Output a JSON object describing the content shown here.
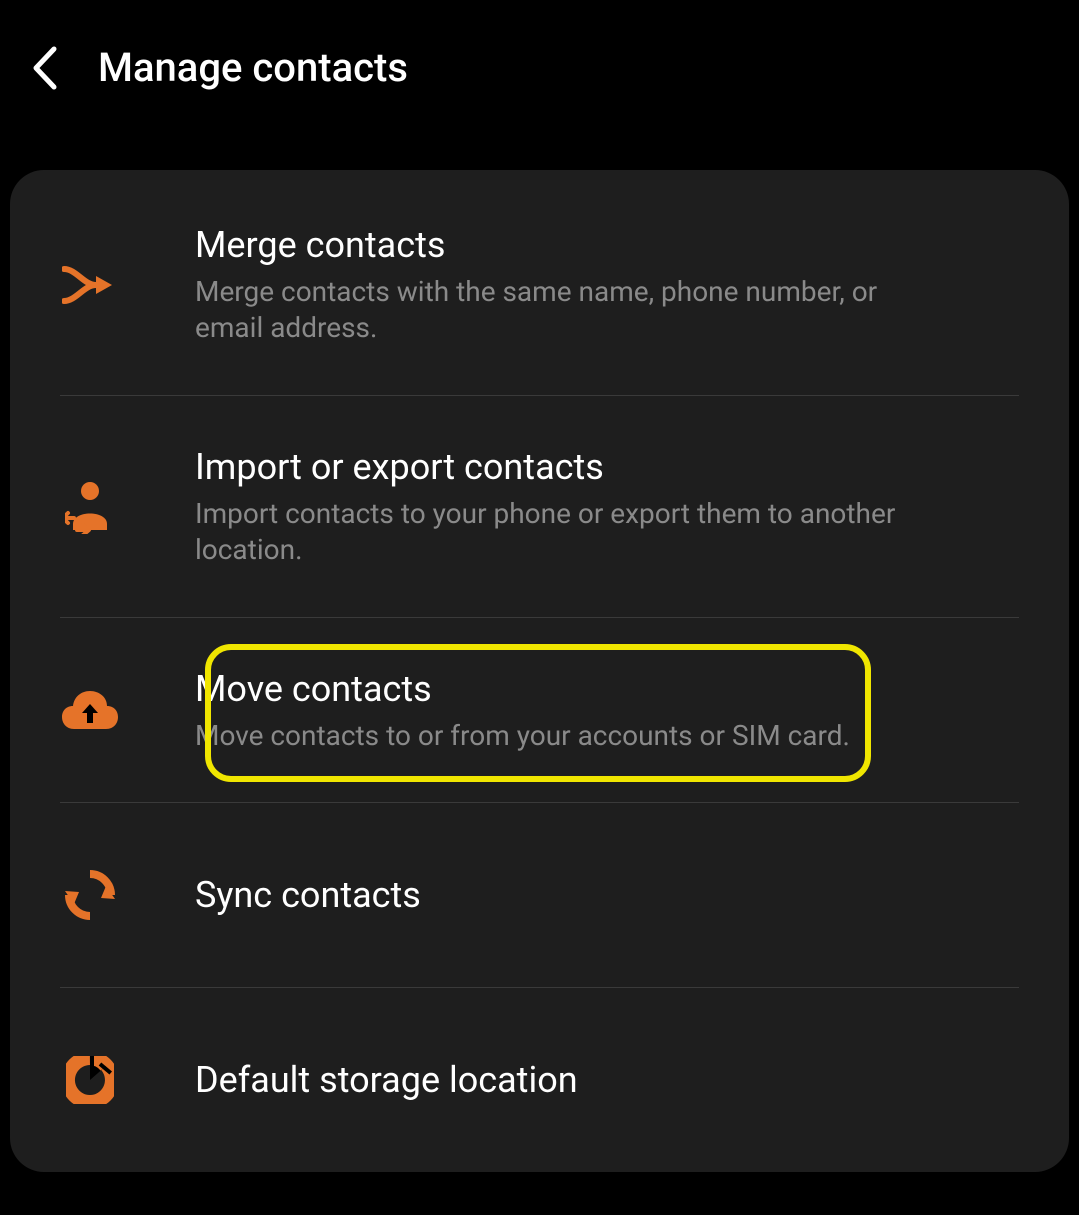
{
  "header": {
    "title": "Manage contacts"
  },
  "items": [
    {
      "title": "Merge contacts",
      "subtitle": "Merge contacts with the same name, phone number, or email address."
    },
    {
      "title": "Import or export contacts",
      "subtitle": "Import contacts to your phone or export them to another location."
    },
    {
      "title": "Move contacts",
      "subtitle": "Move contacts to or from your accounts or SIM card."
    },
    {
      "title": "Sync contacts"
    },
    {
      "title": "Default storage location"
    }
  ],
  "colors": {
    "accent": "#e57329",
    "highlight": "#f0e600"
  }
}
